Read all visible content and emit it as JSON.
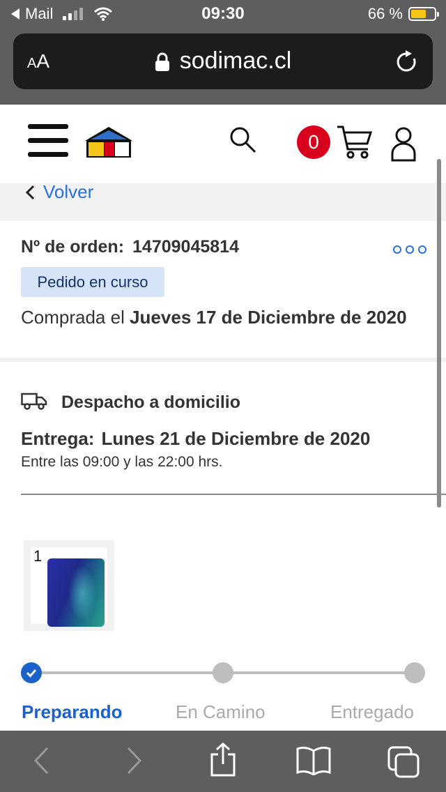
{
  "status_bar": {
    "back_app": "Mail",
    "time": "09:30",
    "battery": "66 %",
    "battery_level": 0.66
  },
  "browser": {
    "text_size": "AA",
    "host": "sodimac.cl"
  },
  "header": {
    "cart_count": "0"
  },
  "nav": {
    "back_label": "Volver"
  },
  "order": {
    "number_label": "Nº de orden:",
    "number": "14709045814",
    "status": "Pedido en curso",
    "purchased_prefix": "Comprada el",
    "purchased_date": "Jueves 17 de Diciembre de 2020"
  },
  "delivery": {
    "title": "Despacho a domicilio",
    "date_label": "Entrega:",
    "date": "Lunes 21 de Diciembre de 2020",
    "window": "Entre las 09:00 y las 22:00 hrs."
  },
  "product": {
    "quantity": "1"
  },
  "tracker": {
    "steps": [
      {
        "label": "Preparando",
        "done": true
      },
      {
        "label": "En Camino",
        "done": false
      },
      {
        "label": "Entregado",
        "done": false
      }
    ]
  },
  "colors": {
    "brand_red": "#d8001c",
    "link_blue": "#2a6fd6",
    "active_blue": "#1a62c9",
    "chip_bg": "#d6e4f7",
    "safari_gray": "#5e5e5e"
  }
}
